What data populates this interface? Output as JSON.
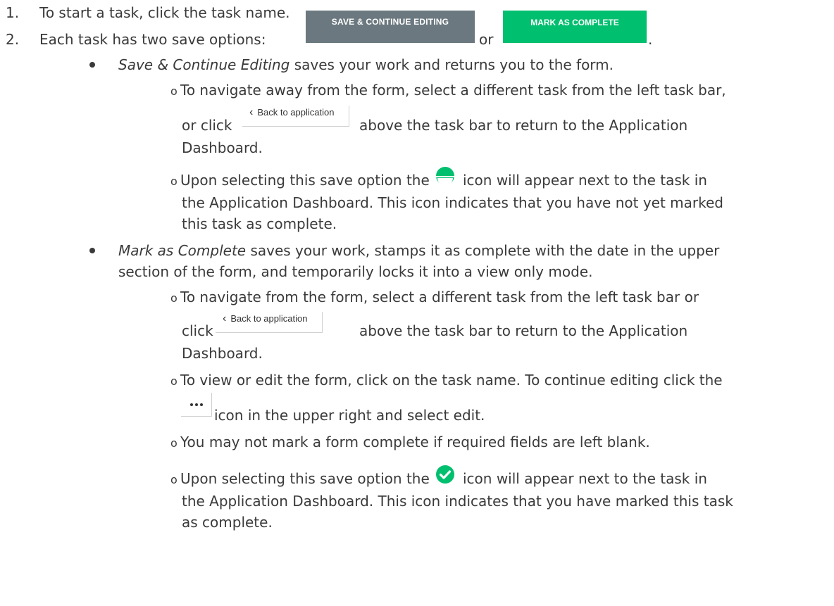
{
  "steps": [
    {
      "number": "1.",
      "text": "To start a task, click the task name."
    },
    {
      "number": "2.",
      "text_before": "Each task has two save options:",
      "text_between": "or",
      "text_after": "."
    }
  ],
  "buttons": {
    "save_continue": "SAVE & CONTINUE EDITING",
    "mark_complete": "MARK AS COMPLETE",
    "back_to_application": "Back to application"
  },
  "bullet_save": {
    "term": "Save & Continue Editing",
    "text": "saves your work and returns you to the form.",
    "sub1_line1": "To navigate away from the form, select a different task from the left task bar,",
    "sub1_pre": "or click",
    "sub1_post": "above the task bar to return to the Application",
    "sub1_line3": "Dashboard.",
    "sub2_pre": "Upon selecting this save option the",
    "sub2_post": "icon will appear next to the task in",
    "sub2_line2": "the Application Dashboard. This icon indicates that you have not yet marked",
    "sub2_line3": "this task as complete."
  },
  "bullet_complete": {
    "term": "Mark as Complete",
    "text_line1": "saves your work, stamps it as complete with the date in the upper",
    "text_line2": "section of the form, and temporarily locks it into a view only mode.",
    "sub1_line1": "To navigate from the form, select a different task from the left task bar or",
    "sub1_pre": "click",
    "sub1_post": "above the task bar to return to the Application",
    "sub1_line3": "Dashboard.",
    "sub2_line1": "To view or edit the form, click on the task name. To continue editing click the",
    "sub2_post": "icon in the upper right and select edit.",
    "sub3": "You may not mark a form complete if required fields are left blank.",
    "sub4_pre": "Upon selecting this save option the",
    "sub4_post": "icon will appear next to the task in",
    "sub4_line2": "the Application Dashboard. This icon indicates that you have marked this task",
    "sub4_line3": "as complete."
  },
  "sub_marker": "o",
  "colors": {
    "text": "#3a3a3a",
    "save_button": "#6b787f",
    "complete_button": "#00bf6f",
    "status_icon": "#00bf6f"
  },
  "icons": {
    "half_circle": "partial-status-icon",
    "check": "complete-status-icon",
    "more": "more-options-icon",
    "back": "chevron-left-icon"
  }
}
